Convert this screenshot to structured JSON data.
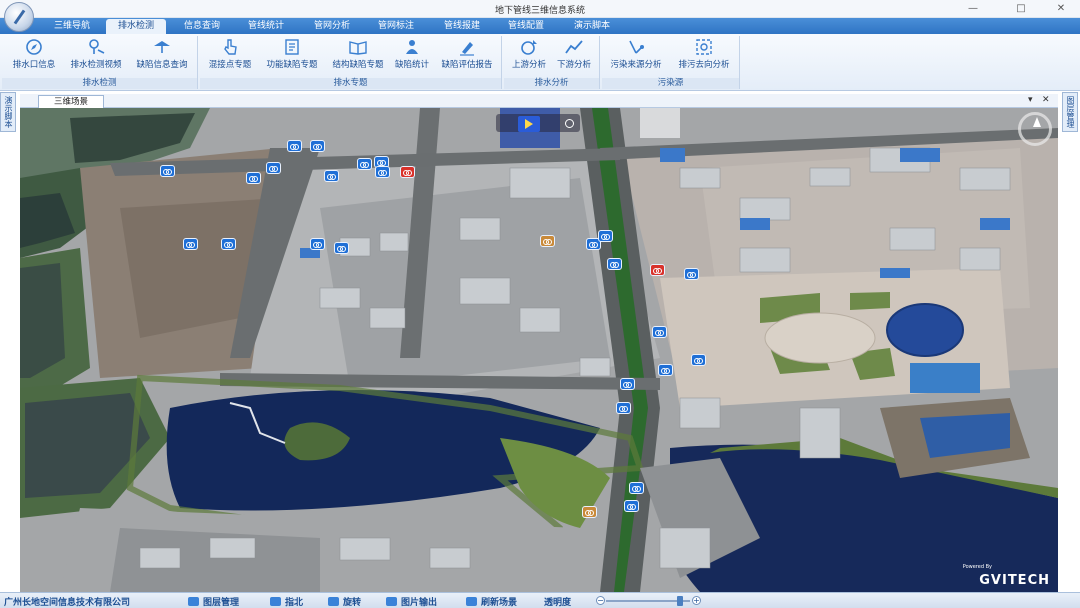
{
  "window": {
    "title": "地下管线三维信息系统",
    "controls": {
      "minimize": "—",
      "maximize": "□",
      "close": "✕"
    }
  },
  "menu": {
    "tabs": [
      {
        "label": "三维导航",
        "active": false
      },
      {
        "label": "排水检测",
        "active": true
      },
      {
        "label": "信息查询",
        "active": false
      },
      {
        "label": "管线统计",
        "active": false
      },
      {
        "label": "管网分析",
        "active": false
      },
      {
        "label": "管网标注",
        "active": false
      },
      {
        "label": "管线报建",
        "active": false
      },
      {
        "label": "管线配置",
        "active": false
      },
      {
        "label": "演示脚本",
        "active": false
      }
    ]
  },
  "ribbon": {
    "groups": [
      {
        "label": "排水检测",
        "buttons": [
          {
            "label": "排水口信息",
            "icon": "compass-icon"
          },
          {
            "label": "排水检测视频",
            "icon": "video-pin-icon"
          },
          {
            "label": "缺陷信息查询",
            "icon": "defect-query-icon"
          }
        ]
      },
      {
        "label": "排水专题",
        "buttons": [
          {
            "label": "混接点专题",
            "icon": "hand-pointer-icon"
          },
          {
            "label": "功能缺陷专题",
            "icon": "document-icon"
          },
          {
            "label": "结构缺陷专题",
            "icon": "book-icon"
          },
          {
            "label": "缺陷统计",
            "icon": "stats-person-icon"
          },
          {
            "label": "缺陷评估报告",
            "icon": "report-pen-icon"
          }
        ]
      },
      {
        "label": "排水分析",
        "buttons": [
          {
            "label": "上游分析",
            "icon": "upstream-icon"
          },
          {
            "label": "下游分析",
            "icon": "downstream-icon"
          }
        ]
      },
      {
        "label": "污染源",
        "buttons": [
          {
            "label": "污染来源分析",
            "icon": "pollution-source-icon"
          },
          {
            "label": "排污去向分析",
            "icon": "discharge-direction-icon"
          }
        ]
      }
    ]
  },
  "side": {
    "left_label": "演示脚本",
    "right_label": "图层管理"
  },
  "doc": {
    "tab_label": "三维场景",
    "menu_glyph": "▾",
    "close_glyph": "✕"
  },
  "map": {
    "brand_small": "Powered By",
    "brand": "GVITECH",
    "water_color": "#13285a",
    "marker_color": "#1f6fd6"
  },
  "status": {
    "company": "广州长地空间信息技术有限公司",
    "buttons": [
      {
        "label": "图层管理",
        "icon": "layers-icon"
      },
      {
        "label": "指北",
        "icon": "north-arrow-icon"
      },
      {
        "label": "旋转",
        "icon": "rotate-icon"
      },
      {
        "label": "图片输出",
        "icon": "image-export-icon"
      },
      {
        "label": "刷新场景",
        "icon": "refresh-icon"
      }
    ],
    "transparency_label": "透明度",
    "transparency_level": 0.88
  }
}
